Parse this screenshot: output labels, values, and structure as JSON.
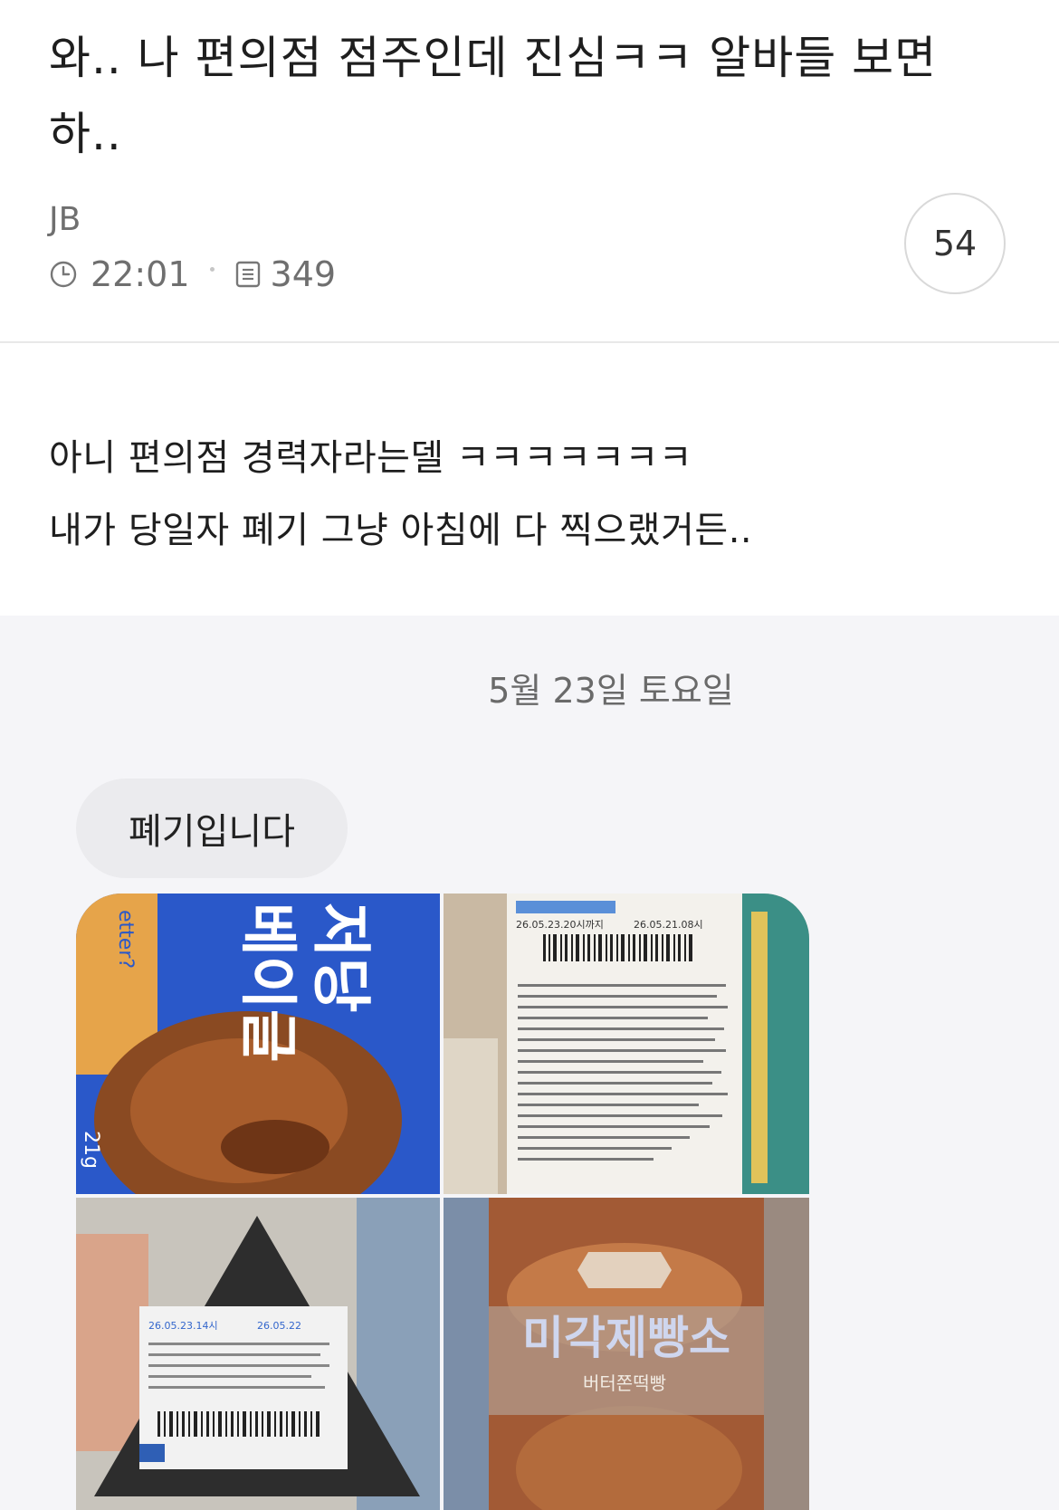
{
  "post": {
    "title": "와.. 나 편의점 점주인데 진심ㅋㅋ 알바들 보면 하..",
    "author": "JB",
    "time": "22:01",
    "views": "349",
    "comment_count": "54",
    "body_lines": [
      "아니 편의점 경력자라는델 ㅋㅋㅋㅋㅋㅋㅋ",
      "내가 당일자 폐기 그냥 아침에 다 찍으랬거든.."
    ]
  },
  "icons": {
    "time": "clock-icon",
    "views": "document-icon"
  },
  "chat": {
    "date": "5월 23일 토요일",
    "message": "폐기입니다",
    "photos": [
      {
        "id": "photo-bread",
        "printed_text": [
          "저당",
          "베이글",
          "21g",
          "etter?"
        ]
      },
      {
        "id": "photo-label",
        "printed_text": [
          "26.05.23.20시까지",
          "26.05.21.08시"
        ]
      },
      {
        "id": "photo-onigiri",
        "printed_text": [
          "26.05.23.14시",
          "26.05.22"
        ]
      },
      {
        "id": "photo-bakery",
        "printed_text": [
          "미각제빵소",
          "버터쫀떡빵"
        ]
      }
    ]
  },
  "colors": {
    "text_primary": "#1e1e1e",
    "text_secondary": "#6f6f6f",
    "chat_bg": "#f5f5f8",
    "bubble_bg": "#ebebee",
    "divider": "#e8e8e8"
  }
}
